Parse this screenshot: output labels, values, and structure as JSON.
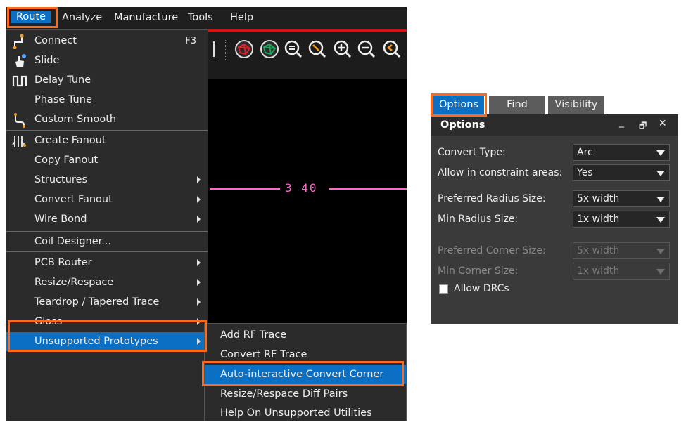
{
  "menubar": {
    "items": [
      {
        "label": "Route",
        "active": true
      },
      {
        "label": "Analyze"
      },
      {
        "label": "Manufacture"
      },
      {
        "label": "Tools"
      },
      {
        "label": "Help"
      }
    ]
  },
  "toolbar": {
    "icons": [
      "ratsnest-red-icon",
      "ratsnest-green-icon",
      "zoom-list-icon",
      "zoom-pan-icon",
      "zoom-in-icon",
      "zoom-out-icon",
      "zoom-previous-icon"
    ]
  },
  "canvas": {
    "text": "3 40"
  },
  "route_menu": {
    "items": [
      {
        "label": "Connect",
        "shortcut": "F3",
        "icon": "connect-icon"
      },
      {
        "label": "Slide",
        "icon": "slide-hand-icon"
      },
      {
        "label": "Delay Tune",
        "icon": "delay-tune-icon"
      },
      {
        "label": "Phase Tune"
      },
      {
        "label": "Custom Smooth",
        "icon": "custom-smooth-icon"
      },
      {
        "label": "Create Fanout",
        "icon": "fanout-icon"
      },
      {
        "label": "Copy Fanout"
      },
      {
        "label": "Structures",
        "submenu": true
      },
      {
        "label": "Convert Fanout",
        "submenu": true
      },
      {
        "label": "Wire Bond",
        "submenu": true
      },
      {
        "label": "Coil Designer..."
      },
      {
        "label": "PCB Router",
        "submenu": true
      },
      {
        "label": "Resize/Respace",
        "submenu": true
      },
      {
        "label": "Teardrop / Tapered Trace",
        "submenu": true
      },
      {
        "label": "Gloss",
        "submenu": true
      },
      {
        "label": "Unsupported Prototypes",
        "submenu": true,
        "highlighted": true
      }
    ]
  },
  "submenu": {
    "items": [
      {
        "label": "Add RF Trace"
      },
      {
        "label": "Convert RF Trace"
      },
      {
        "label": "Auto-interactive Convert Corner",
        "highlighted": true
      },
      {
        "label": "Resize/Respace Diff Pairs"
      },
      {
        "label": "Help On Unsupported Utilities"
      }
    ]
  },
  "panel": {
    "tabs": [
      {
        "label": "Options",
        "active": true
      },
      {
        "label": "Find"
      },
      {
        "label": "Visibility"
      }
    ],
    "title": "Options",
    "header_buttons": {
      "minimize": "_",
      "restore": "🗗",
      "close": "✕"
    },
    "fields": [
      {
        "label": "Convert Type:",
        "value": "Arc",
        "enabled": true
      },
      {
        "label": "Allow in constraint areas:",
        "value": "Yes",
        "enabled": true
      },
      {
        "label": "Preferred Radius Size:",
        "value": "5x width",
        "enabled": true
      },
      {
        "label": "Min Radius Size:",
        "value": "1x width",
        "enabled": true
      },
      {
        "label": "Preferred Corner Size:",
        "value": "5x width",
        "enabled": false
      },
      {
        "label": "Min Corner Size:",
        "value": "1x width",
        "enabled": false
      }
    ],
    "checkbox": {
      "label": "Allow DRCs",
      "checked": false
    }
  },
  "colors": {
    "accent": "#0b6fc4",
    "highlight_box": "#ff6a1a",
    "canvas_trace": "#ff66cc",
    "toolbar_border": "#d31515"
  }
}
